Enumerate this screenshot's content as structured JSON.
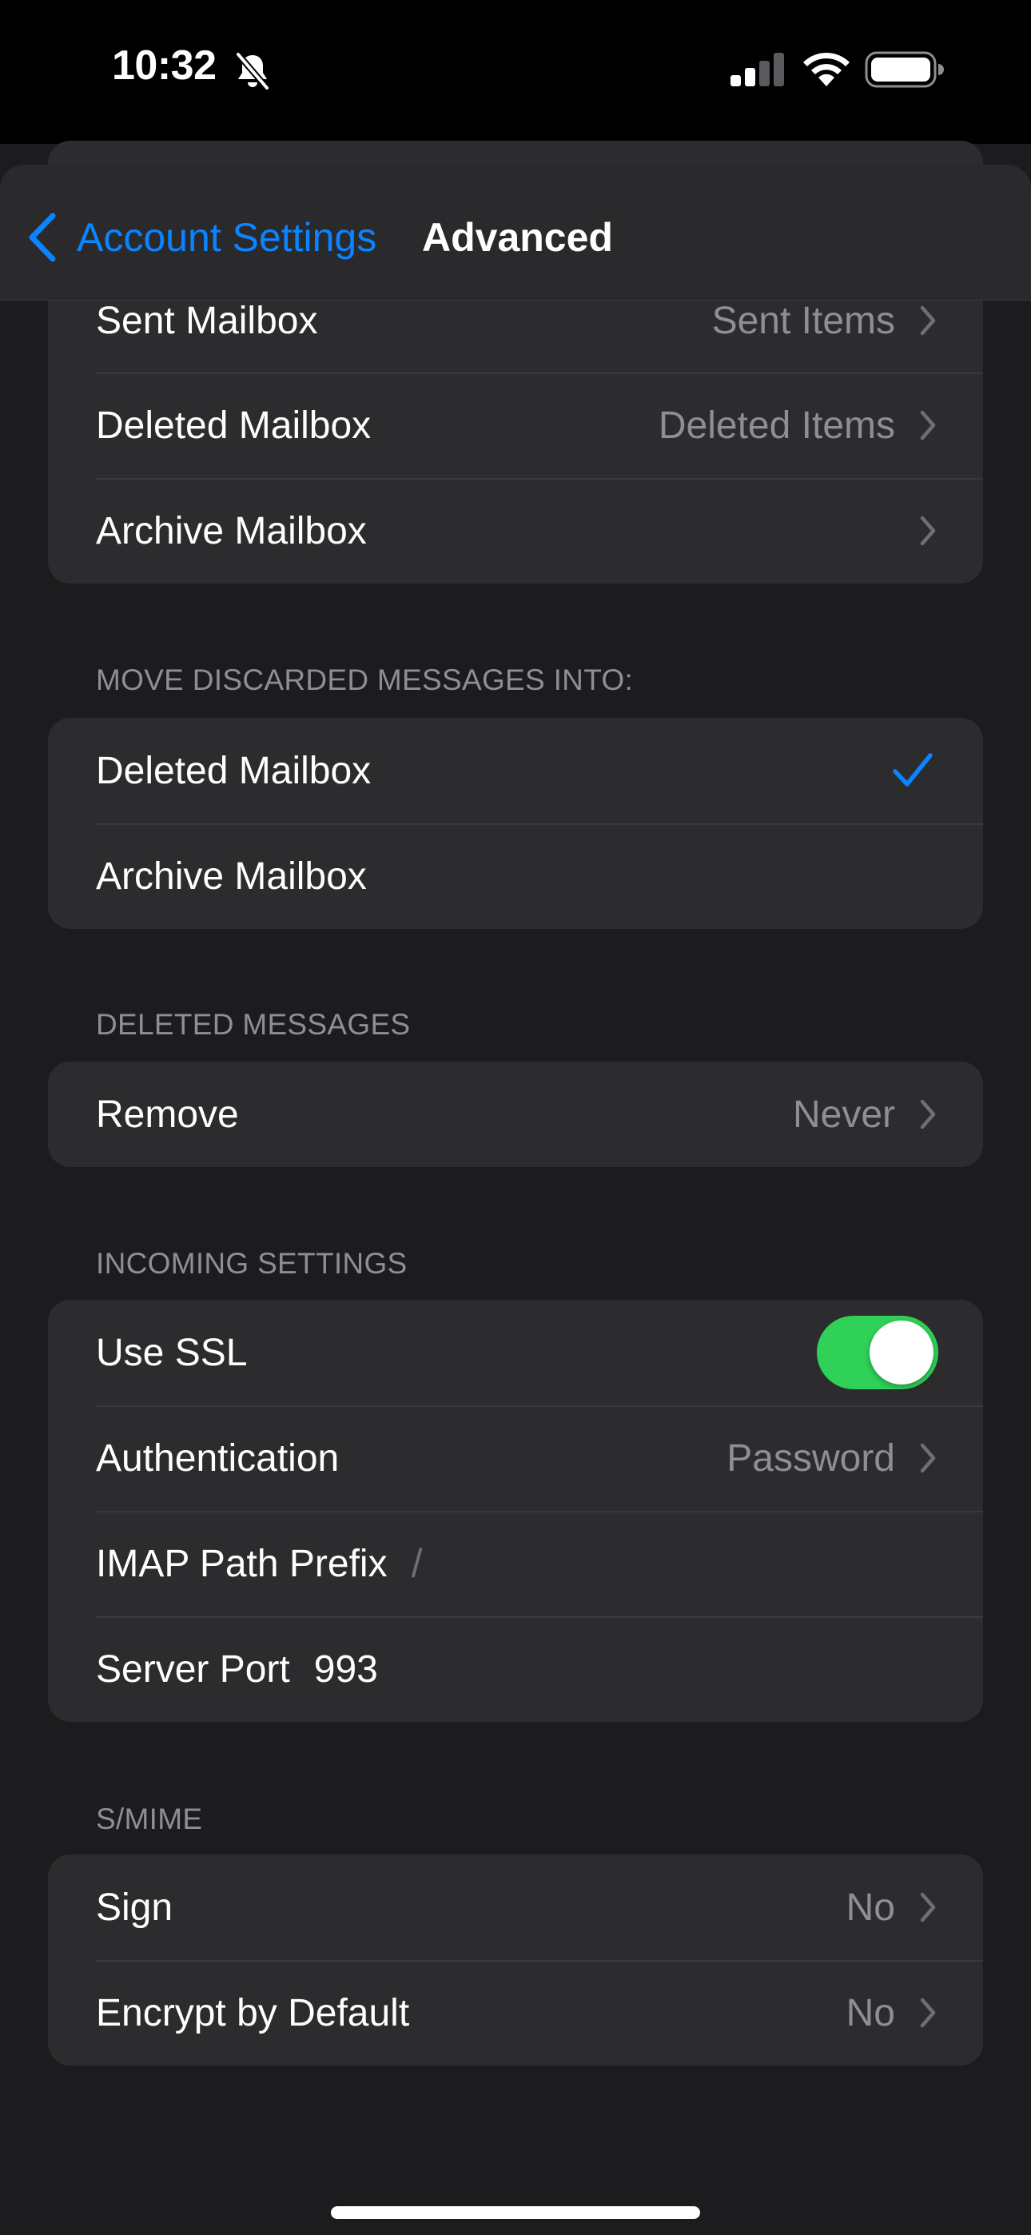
{
  "status_bar": {
    "time": "10:32",
    "icons": [
      "bell-slash-icon",
      "cellular-signal-icon",
      "wifi-icon",
      "battery-icon"
    ]
  },
  "nav": {
    "back_label": "Account Settings",
    "title": "Advanced"
  },
  "mailbox_behaviors": {
    "rows": [
      {
        "label": "Sent Mailbox",
        "value": "Sent Items"
      },
      {
        "label": "Deleted Mailbox",
        "value": "Deleted Items"
      },
      {
        "label": "Archive Mailbox",
        "value": ""
      }
    ]
  },
  "discarded": {
    "header": "MOVE DISCARDED MESSAGES INTO:",
    "options": [
      {
        "label": "Deleted Mailbox",
        "selected": true
      },
      {
        "label": "Archive Mailbox",
        "selected": false
      }
    ]
  },
  "deleted_messages": {
    "header": "DELETED MESSAGES",
    "remove_label": "Remove",
    "remove_value": "Never"
  },
  "incoming": {
    "header": "INCOMING SETTINGS",
    "use_ssl_label": "Use SSL",
    "use_ssl_on": true,
    "auth_label": "Authentication",
    "auth_value": "Password",
    "imap_prefix_label": "IMAP Path Prefix",
    "imap_prefix_value": "/",
    "server_port_label": "Server Port",
    "server_port_value": "993"
  },
  "smime": {
    "header": "S/MIME",
    "sign_label": "Sign",
    "sign_value": "No",
    "encrypt_label": "Encrypt by Default",
    "encrypt_value": "No"
  },
  "colors": {
    "accent": "#0a84ff",
    "toggle_on": "#30d158",
    "background": "#1c1c1e",
    "cell": "#2c2c2e"
  }
}
